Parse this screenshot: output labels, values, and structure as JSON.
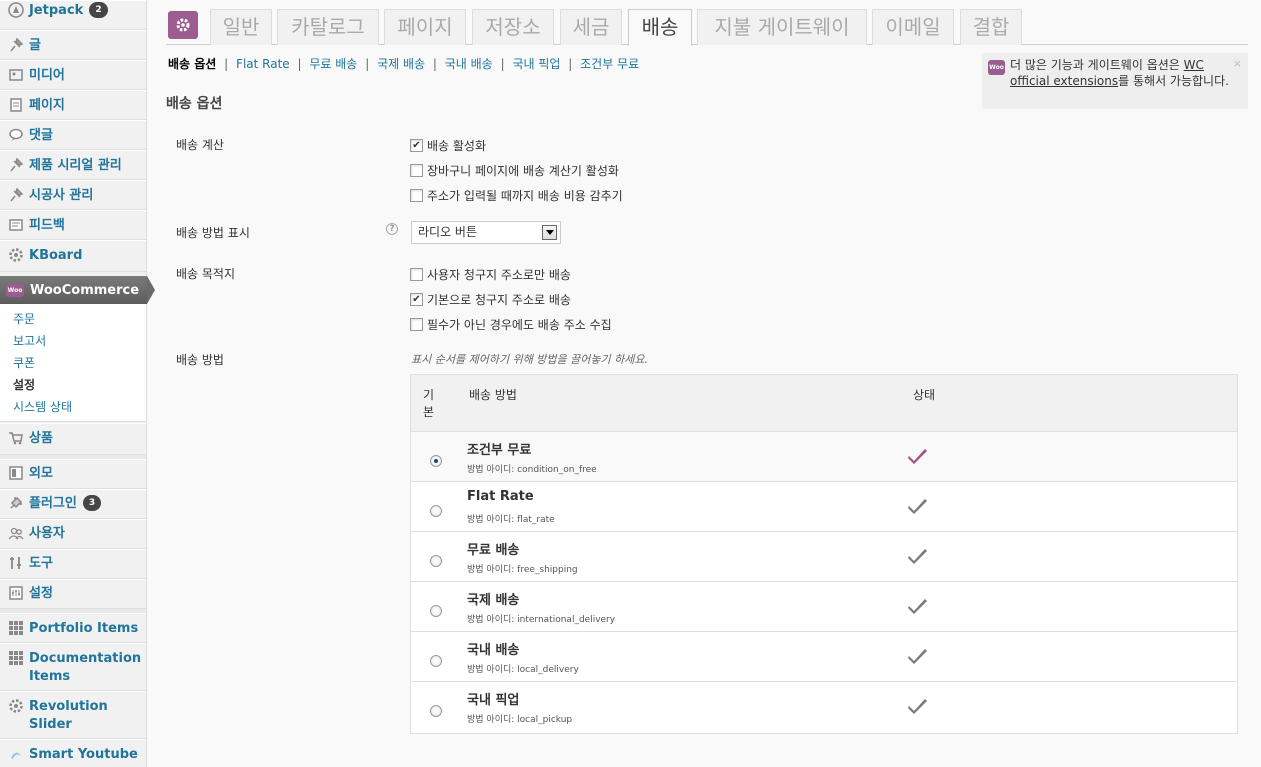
{
  "sidebar": {
    "items": [
      {
        "key": "jetpack",
        "label": "Jetpack",
        "icon": "jetpack-icon",
        "badge": "2"
      },
      {
        "key": "posts",
        "label": "글",
        "icon": "pin-icon"
      },
      {
        "key": "media",
        "label": "미디어",
        "icon": "media-icon"
      },
      {
        "key": "pages",
        "label": "페이지",
        "icon": "page-icon"
      },
      {
        "key": "comments",
        "label": "댓글",
        "icon": "comment-icon"
      },
      {
        "key": "serial",
        "label": "제품 시리얼 관리",
        "icon": "pin-icon"
      },
      {
        "key": "contractor",
        "label": "시공사 관리",
        "icon": "pin-icon"
      },
      {
        "key": "feedback",
        "label": "피드백",
        "icon": "feedback-icon"
      },
      {
        "key": "kboard",
        "label": "KBoard",
        "icon": "gear-icon"
      }
    ],
    "woocommerce": {
      "label": "WooCommerce",
      "icon_text": "Woo",
      "submenu": [
        "주문",
        "보고서",
        "쿠폰",
        "설정",
        "시스템 상태"
      ],
      "current_submenu": "설정"
    },
    "items_after": [
      {
        "key": "products",
        "label": "상품",
        "icon": "cart-icon"
      },
      {
        "key": "appearance",
        "label": "외모",
        "icon": "appearance-icon"
      },
      {
        "key": "plugins",
        "label": "플러그인",
        "icon": "plugin-icon",
        "badge": "3"
      },
      {
        "key": "users",
        "label": "사용자",
        "icon": "users-icon"
      },
      {
        "key": "tools",
        "label": "도구",
        "icon": "tools-icon"
      },
      {
        "key": "settings",
        "label": "설정",
        "icon": "settings-icon"
      },
      {
        "key": "portfolio",
        "label": "Portfolio Items",
        "icon": "grid-icon"
      },
      {
        "key": "documentation",
        "label": "Documentation Items",
        "icon": "grid-icon"
      },
      {
        "key": "revolution",
        "label": "Revolution Slider",
        "icon": "gear-icon"
      },
      {
        "key": "youtube",
        "label": "Smart Youtube",
        "icon": "youtube-icon"
      }
    ]
  },
  "tabs": [
    "일반",
    "카탈로그",
    "페이지",
    "저장소",
    "세금",
    "배송",
    "지불 게이트웨이",
    "이메일",
    "결합"
  ],
  "active_tab": "배송",
  "subnav": {
    "current": "배송 옵션",
    "links": [
      "Flat Rate",
      "무료 배송",
      "국제 배송",
      "국내 배송",
      "국내 픽업",
      "조건부 무료"
    ],
    "separator": "|"
  },
  "notice": {
    "icon_text": "Woo",
    "text_before": "더 많은 기능과 게이트웨이 옵션은 ",
    "link": "WC official extensions",
    "text_after": "를 통해서 가능합니다.",
    "close": "×"
  },
  "section_title": "배송 옵션",
  "calc": {
    "label": "배송 계산",
    "options": [
      {
        "label": "배송 활성화",
        "checked": true
      },
      {
        "label": "장바구니 페이지에 배송 계산기 활성화",
        "checked": false
      },
      {
        "label": "주소가 입력될 때까지 배송 비용 감추기",
        "checked": false
      }
    ]
  },
  "display": {
    "label": "배송 방법 표시",
    "help": "?",
    "selected": "라디오 버튼"
  },
  "destination": {
    "label": "배송 목적지",
    "options": [
      {
        "label": "사용자 청구지 주소로만 배송",
        "checked": false
      },
      {
        "label": "기본으로 청구지 주소로 배송",
        "checked": true
      },
      {
        "label": "필수가 아닌 경우에도 배송 주소 수집",
        "checked": false
      }
    ]
  },
  "methods": {
    "label": "배송 방법",
    "hint": "표시 순서를 제어하기 위해 방법을 끌어놓기 하세요.",
    "headers": {
      "default_1": "기",
      "default_2": "본",
      "method": "배송 방법",
      "status": "상태"
    },
    "rows": [
      {
        "name": "조건부 무료",
        "id": "방법 아이디: condition_on_free",
        "default": true,
        "status_color": "#a3508f"
      },
      {
        "name": "Flat Rate",
        "id": "방법 아이디: flat_rate",
        "default": false,
        "status_color": "#7a7a7a"
      },
      {
        "name": "무료 배송",
        "id": "방법 아이디: free_shipping",
        "default": false,
        "status_color": "#7a7a7a"
      },
      {
        "name": "국제 배송",
        "id": "방법 아이디: international_delivery",
        "default": false,
        "status_color": "#7a7a7a"
      },
      {
        "name": "국내 배송",
        "id": "방법 아이디: local_delivery",
        "default": false,
        "status_color": "#7a7a7a"
      },
      {
        "name": "국내 픽업",
        "id": "방법 아이디: local_pickup",
        "default": false,
        "status_color": "#7a7a7a"
      }
    ]
  },
  "colors": {
    "link": "#21759b",
    "woo_purple": "#9b5c8f",
    "active_check": "#a3508f",
    "inactive_check": "#7a7a7a"
  }
}
